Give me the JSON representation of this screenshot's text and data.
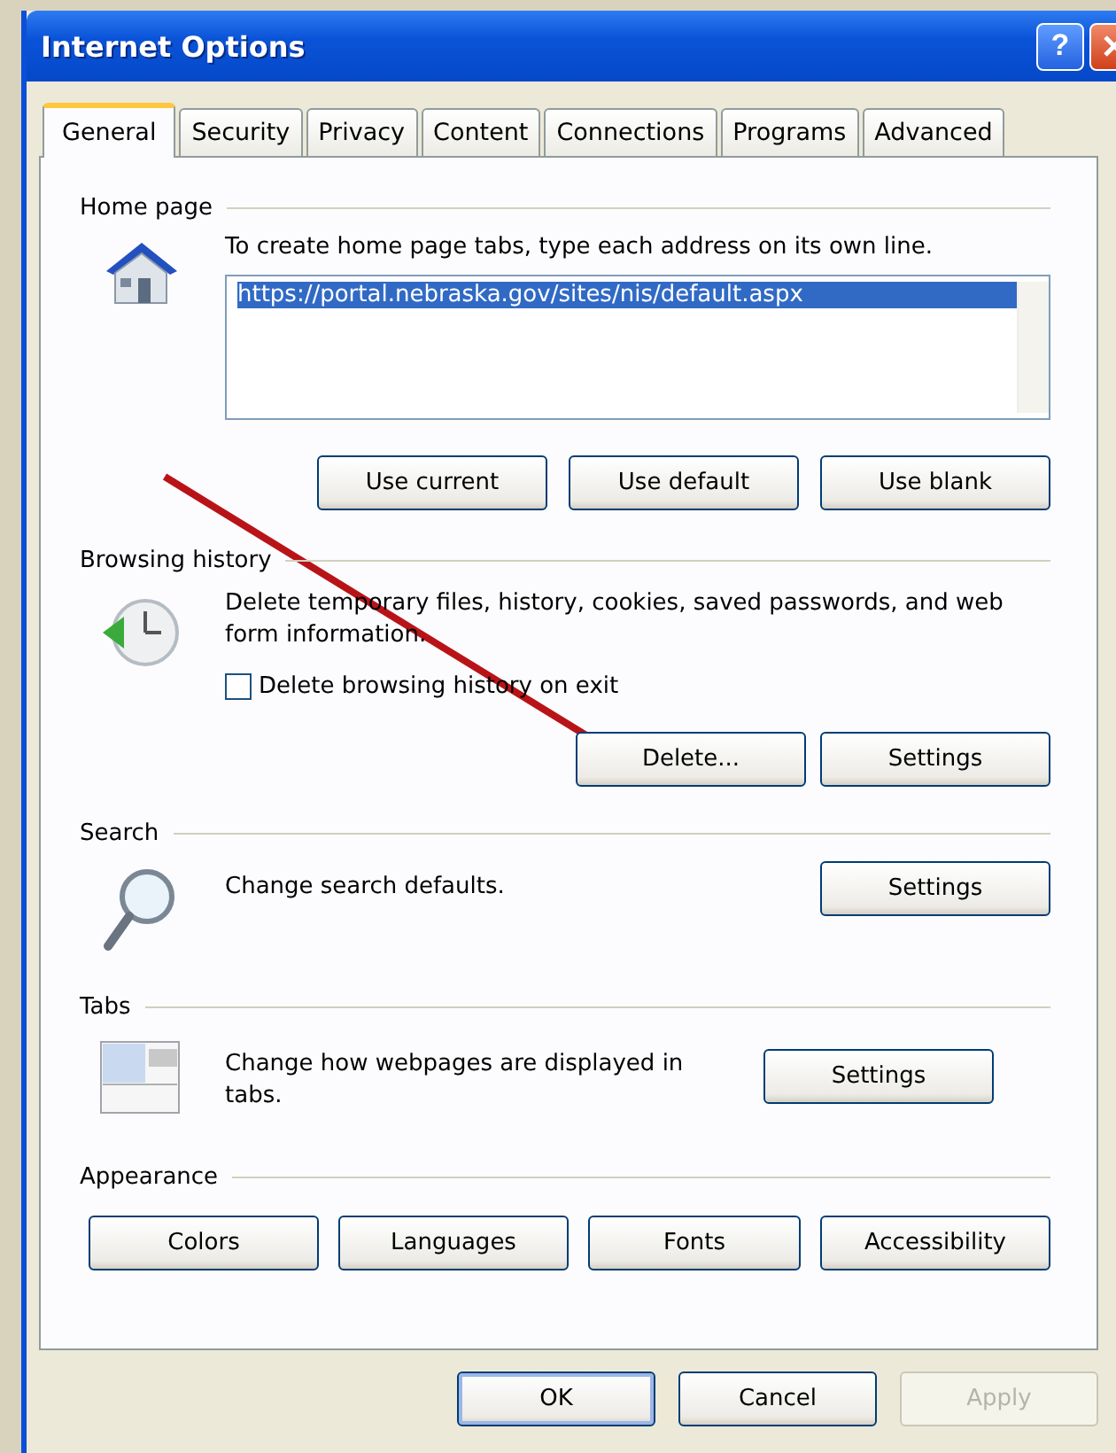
{
  "window": {
    "title": "Internet Options",
    "help_button": "?"
  },
  "tabs": [
    {
      "label": "General",
      "selected": true
    },
    {
      "label": "Security",
      "selected": false
    },
    {
      "label": "Privacy",
      "selected": false
    },
    {
      "label": "Content",
      "selected": false
    },
    {
      "label": "Connections",
      "selected": false
    },
    {
      "label": "Programs",
      "selected": false
    },
    {
      "label": "Advanced",
      "selected": false
    }
  ],
  "home_page": {
    "label": "Home page",
    "description": "To create home page tabs, type each address on its own line.",
    "address": {
      "value": "https://portal.nebraska.gov/sites/nis/default.aspx",
      "selected": true
    },
    "buttons": [
      "Use current",
      "Use default",
      "Use blank"
    ]
  },
  "browsing_history": {
    "label": "Browsing history",
    "description": "Delete temporary files, history, cookies, saved passwords, and web form information.",
    "checkbox": {
      "label": "Delete browsing history on exit",
      "checked": false
    },
    "buttons": [
      "Delete...",
      "Settings"
    ]
  },
  "search": {
    "label": "Search",
    "description": "Change search defaults.",
    "button": "Settings"
  },
  "tabs_section": {
    "label": "Tabs",
    "description": "Change how webpages are displayed in tabs.",
    "button": "Settings"
  },
  "appearance": {
    "label": "Appearance",
    "buttons": [
      "Colors",
      "Languages",
      "Fonts",
      "Accessibility"
    ]
  },
  "footer_buttons": [
    {
      "label": "OK",
      "disabled": false,
      "default": true
    },
    {
      "label": "Cancel",
      "disabled": false,
      "default": false
    },
    {
      "label": "Apply",
      "disabled": true,
      "default": false
    }
  ]
}
